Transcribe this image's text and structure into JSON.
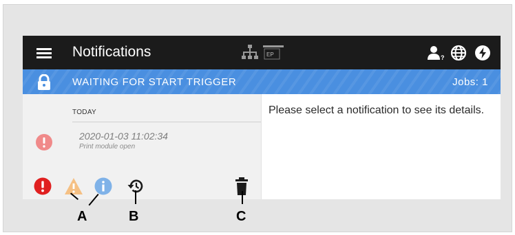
{
  "header": {
    "title": "Notifications",
    "ep_label": "EP",
    "user_suffix": "?"
  },
  "status": {
    "text": "WAITING FOR START TRIGGER",
    "jobs": "Jobs: 1",
    "color": "#4a8fe0"
  },
  "list": {
    "section": "TODAY",
    "items": [
      {
        "timestamp": "2020-01-03 11:02:34",
        "message": "Print module open",
        "severity": "error"
      }
    ]
  },
  "detail": {
    "placeholder": "Please select a notification to see its details."
  },
  "footer": {
    "filters": [
      "error",
      "warning",
      "info"
    ],
    "icons": [
      "history-icon",
      "trash-icon"
    ]
  },
  "callouts": {
    "a": "A",
    "b": "B",
    "c": "C"
  },
  "colors": {
    "error": "#e02020",
    "error_faded": "#f08a8a",
    "warning": "#f5c084",
    "info": "#7fb2e8",
    "topbar": "#1b1b1b"
  }
}
